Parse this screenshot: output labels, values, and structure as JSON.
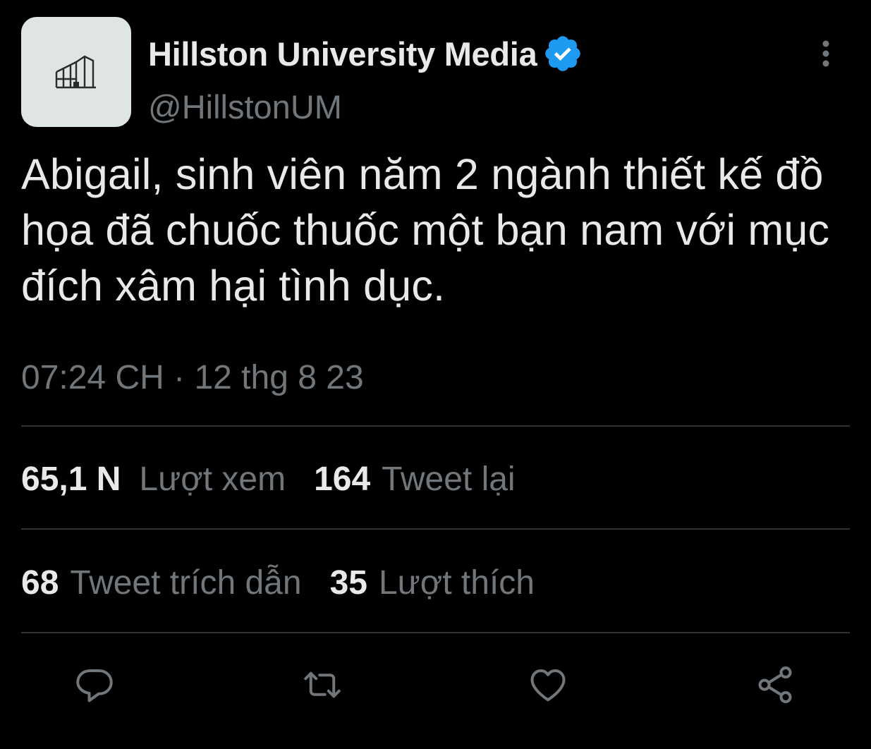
{
  "account": {
    "display_name": "Hillston University Media",
    "handle": "@HillstonUM",
    "verified": true
  },
  "tweet": {
    "text": "Abigail, sinh viên năm 2 ngành thiết kế đồ họa đã chuốc thuốc một bạn nam với mục đích xâm hại tình dục.",
    "timestamp": "07:24 CH · 12 thg 8 23"
  },
  "stats": {
    "views_count": "65,1 N",
    "views_label": "Lượt xem",
    "retweets_count": "164",
    "retweets_label": "Tweet lại",
    "quotes_count": "68",
    "quotes_label": "Tweet trích dẫn",
    "likes_count": "35",
    "likes_label": "Lượt thích"
  },
  "actions": [
    {
      "icon": "reply-icon"
    },
    {
      "icon": "retweet-icon"
    },
    {
      "icon": "like-icon"
    },
    {
      "icon": "share-icon"
    }
  ],
  "colors": {
    "background": "#000000",
    "primary_text": "#e7e9ea",
    "secondary_text": "#71767b",
    "divider": "#2f3336",
    "verified_badge": "#1d9bf0",
    "avatar_bg": "#dfe5e1"
  }
}
